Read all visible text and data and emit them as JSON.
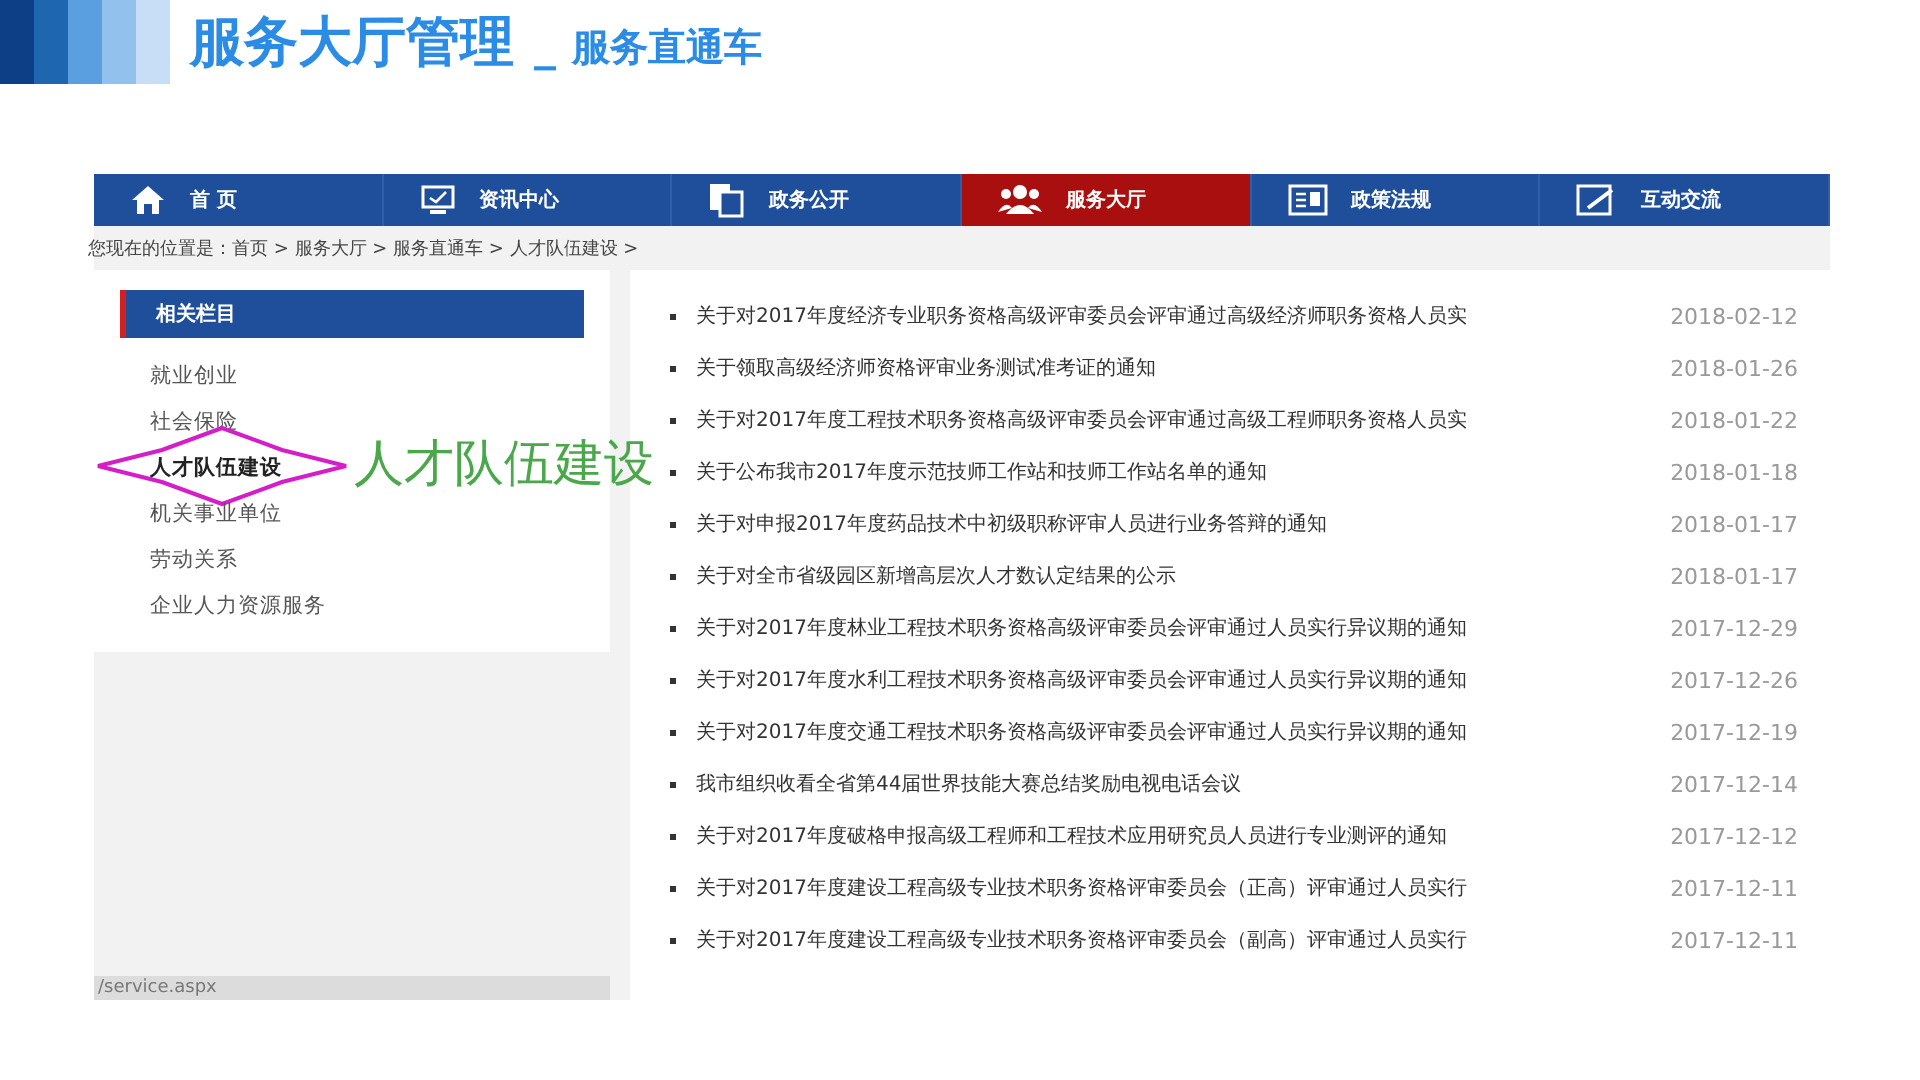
{
  "slide_title": {
    "main": "服务大厅管理",
    "separator": "_",
    "sub": "服务直通车"
  },
  "nav": {
    "tabs": [
      {
        "label": "首 页",
        "selected": false
      },
      {
        "label": "资讯中心",
        "selected": false
      },
      {
        "label": "政务公开",
        "selected": false
      },
      {
        "label": "服务大厅",
        "selected": true
      },
      {
        "label": "政策法规",
        "selected": false
      },
      {
        "label": "互动交流",
        "selected": false
      }
    ]
  },
  "breadcrumb": "您现在的位置是：首页 > 服务大厅 > 服务直通车 > 人才队伍建设 >",
  "sidebar": {
    "heading": "相关栏目",
    "items": [
      {
        "label": "就业创业",
        "selected": false
      },
      {
        "label": "社会保险",
        "selected": false
      },
      {
        "label": "人才队伍建设",
        "selected": true
      },
      {
        "label": "机关事业单位",
        "selected": false
      },
      {
        "label": "劳动关系",
        "selected": false
      },
      {
        "label": "企业人力资源服务",
        "selected": false
      }
    ]
  },
  "callout": "人才队伍建设",
  "news": [
    {
      "title": "关于对2017年度经济专业职务资格高级评审委员会评审通过高级经济师职务资格人员实",
      "date": "2018-02-12"
    },
    {
      "title": "关于领取高级经济师资格评审业务测试准考证的通知",
      "date": "2018-01-26"
    },
    {
      "title": "关于对2017年度工程技术职务资格高级评审委员会评审通过高级工程师职务资格人员实",
      "date": "2018-01-22"
    },
    {
      "title": "关于公布我市2017年度示范技师工作站和技师工作站名单的通知",
      "date": "2018-01-18"
    },
    {
      "title": "关于对申报2017年度药品技术中初级职称评审人员进行业务答辩的通知",
      "date": "2018-01-17"
    },
    {
      "title": "关于对全市省级园区新增高层次人才数认定结果的公示",
      "date": "2018-01-17"
    },
    {
      "title": "关于对2017年度林业工程技术职务资格高级评审委员会评审通过人员实行异议期的通知",
      "date": "2017-12-29"
    },
    {
      "title": "关于对2017年度水利工程技术职务资格高级评审委员会评审通过人员实行异议期的通知",
      "date": "2017-12-26"
    },
    {
      "title": "关于对2017年度交通工程技术职务资格高级评审委员会评审通过人员实行异议期的通知",
      "date": "2017-12-19"
    },
    {
      "title": "我市组织收看全省第44届世界技能大赛总结奖励电视电话会议",
      "date": "2017-12-14"
    },
    {
      "title": "关于对2017年度破格申报高级工程师和工程技术应用研究员人员进行专业测评的通知",
      "date": "2017-12-12"
    },
    {
      "title": "关于对2017年度建设工程高级专业技术职务资格评审委员会（正高）评审通过人员实行",
      "date": "2017-12-11"
    },
    {
      "title": "关于对2017年度建设工程高级专业技术职务资格评审委员会（副高）评审通过人员实行",
      "date": "2017-12-11"
    }
  ],
  "status_bar": "/service.aspx"
}
